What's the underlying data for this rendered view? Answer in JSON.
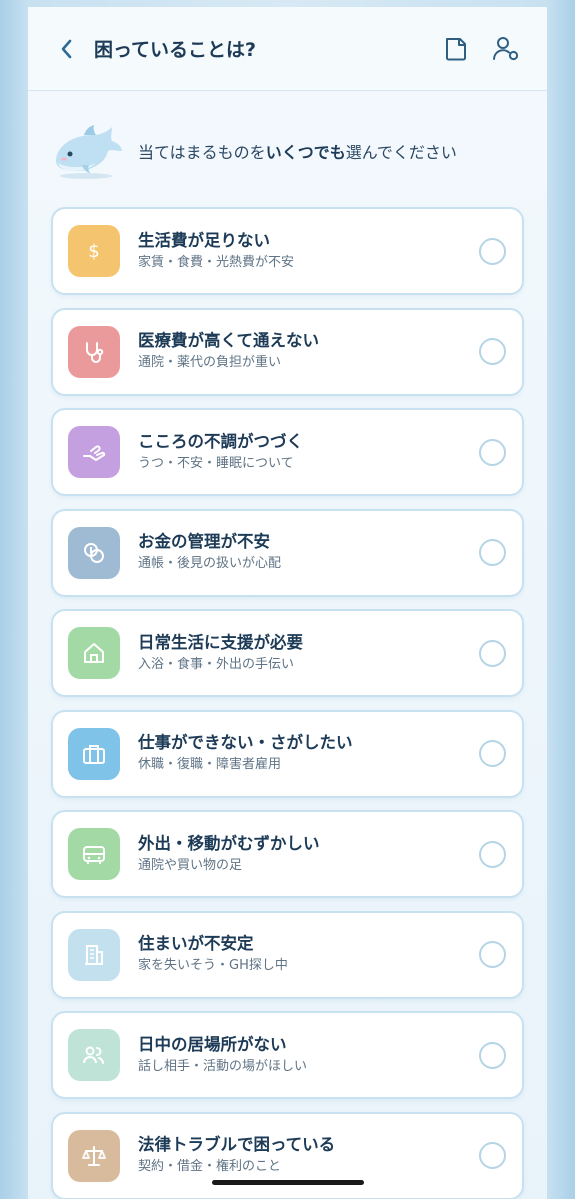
{
  "header": {
    "title": "困っていることは?",
    "back_icon": "chevron-left-icon",
    "note_icon": "note-icon",
    "profile_icon": "user-settings-icon"
  },
  "intro": {
    "text_before": "当てはまるものを",
    "text_bold": "いくつでも",
    "text_after": "選んでください"
  },
  "items": [
    {
      "title": "生活費が足りない",
      "sub": "家賃・食費・光熱費が不安",
      "icon": "dollar-icon",
      "color": "#f5c46e",
      "selected": false
    },
    {
      "title": "医療費が高くて通えない",
      "sub": "通院・薬代の負担が重い",
      "icon": "stethoscope-icon",
      "color": "#ea9a9a",
      "selected": false
    },
    {
      "title": "こころの不調がつづく",
      "sub": "うつ・不安・睡眠について",
      "icon": "hand-heart-icon",
      "color": "#c5a0e0",
      "selected": false
    },
    {
      "title": "お金の管理が不安",
      "sub": "通帳・後見の扱いが心配",
      "icon": "coins-icon",
      "color": "#9fbad3",
      "selected": false
    },
    {
      "title": "日常生活に支援が必要",
      "sub": "入浴・食事・外出の手伝い",
      "icon": "home-icon",
      "color": "#a3d9a5",
      "selected": false
    },
    {
      "title": "仕事ができない・さがしたい",
      "sub": "休職・復職・障害者雇用",
      "icon": "briefcase-icon",
      "color": "#7fc3e8",
      "selected": false
    },
    {
      "title": "外出・移動がむずかしい",
      "sub": "通院や買い物の足",
      "icon": "bus-icon",
      "color": "#a3d9a5",
      "selected": false
    },
    {
      "title": "住まいが不安定",
      "sub": "家を失いそう・GH探し中",
      "icon": "building-icon",
      "color": "#c3e0ef",
      "selected": false
    },
    {
      "title": "日中の居場所がない",
      "sub": "話し相手・活動の場がほしい",
      "icon": "people-icon",
      "color": "#bfe3d6",
      "selected": false
    },
    {
      "title": "法律トラブルで困っている",
      "sub": "契約・借金・権利のこと",
      "icon": "scales-icon",
      "color": "#d8bb9c",
      "selected": false
    }
  ]
}
